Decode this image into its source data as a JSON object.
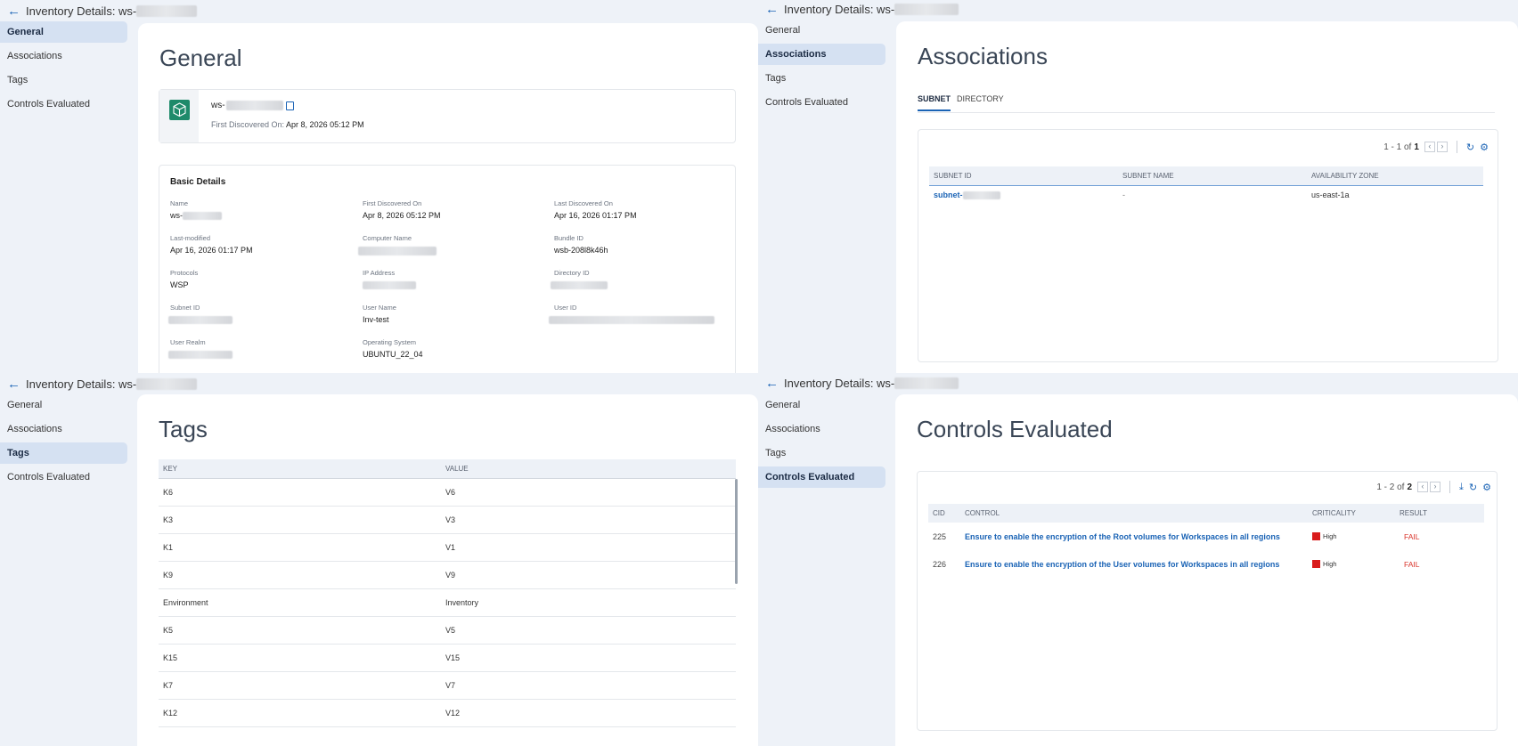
{
  "header": {
    "title_prefix": "Inventory Details: ws-",
    "back_icon": "←"
  },
  "sidebar": {
    "items": [
      "General",
      "Associations",
      "Tags",
      "Controls Evaluated"
    ]
  },
  "general": {
    "title": "General",
    "resource_name_prefix": "ws-",
    "first_discovered_label": "First Discovered On:",
    "first_discovered_value": "Apr 8, 2026 05:12 PM",
    "basic_title": "Basic Details",
    "fields": {
      "name_label": "Name",
      "name_prefix": "ws-",
      "first_label": "First Discovered On",
      "first_value": "Apr 8, 2026 05:12 PM",
      "last_label": "Last Discovered On",
      "last_value": "Apr 16, 2026 01:17 PM",
      "modified_label": "Last-modified",
      "modified_value": "Apr 16, 2026 01:17 PM",
      "computer_label": "Computer Name",
      "bundle_label": "Bundle ID",
      "bundle_value": "wsb-208l8k46h",
      "protocols_label": "Protocols",
      "protocols_value": "WSP",
      "ip_label": "IP Address",
      "directory_label": "Directory ID",
      "subnet_label": "Subnet ID",
      "user_name_label": "User Name",
      "user_name_value": "Inv-test",
      "user_id_label": "User ID",
      "realm_label": "User Realm",
      "os_label": "Operating System",
      "os_value": "UBUNTU_22_04"
    }
  },
  "associations": {
    "title": "Associations",
    "tabs": [
      "SUBNET",
      "DIRECTORY"
    ],
    "pager": {
      "text": "1 - 1 of",
      "total": "1"
    },
    "columns": [
      "SUBNET ID",
      "SUBNET NAME",
      "AVAILABILITY ZONE"
    ],
    "row": {
      "subnet_prefix": "subnet-",
      "name": "-",
      "zone": "us-east-1a"
    }
  },
  "tags": {
    "title": "Tags",
    "columns": [
      "KEY",
      "VALUE"
    ],
    "rows": [
      [
        "K6",
        "V6"
      ],
      [
        "K3",
        "V3"
      ],
      [
        "K1",
        "V1"
      ],
      [
        "K9",
        "V9"
      ],
      [
        "Environment",
        "Inventory"
      ],
      [
        "K5",
        "V5"
      ],
      [
        "K15",
        "V15"
      ],
      [
        "K7",
        "V7"
      ],
      [
        "K12",
        "V12"
      ]
    ]
  },
  "controls": {
    "title": "Controls Evaluated",
    "pager": {
      "text": "1 - 2 of",
      "total": "2"
    },
    "columns": [
      "CID",
      "CONTROL",
      "CRITICALITY",
      "RESULT"
    ],
    "rows": [
      {
        "cid": "225",
        "control": "Ensure to enable the encryption of the Root volumes for Workspaces in all regions",
        "criticality": "High",
        "result": "FAIL"
      },
      {
        "cid": "226",
        "control": "Ensure to enable the encryption of the User volumes for Workspaces in all regions",
        "criticality": "High",
        "result": "FAIL"
      }
    ],
    "colors": {
      "high": "#d91c1c",
      "fail": "#d9342b"
    }
  },
  "colors": {
    "accent": "#1a63b5",
    "active_bg": "#d5e1f2",
    "page_bg": "#eef2f8"
  }
}
